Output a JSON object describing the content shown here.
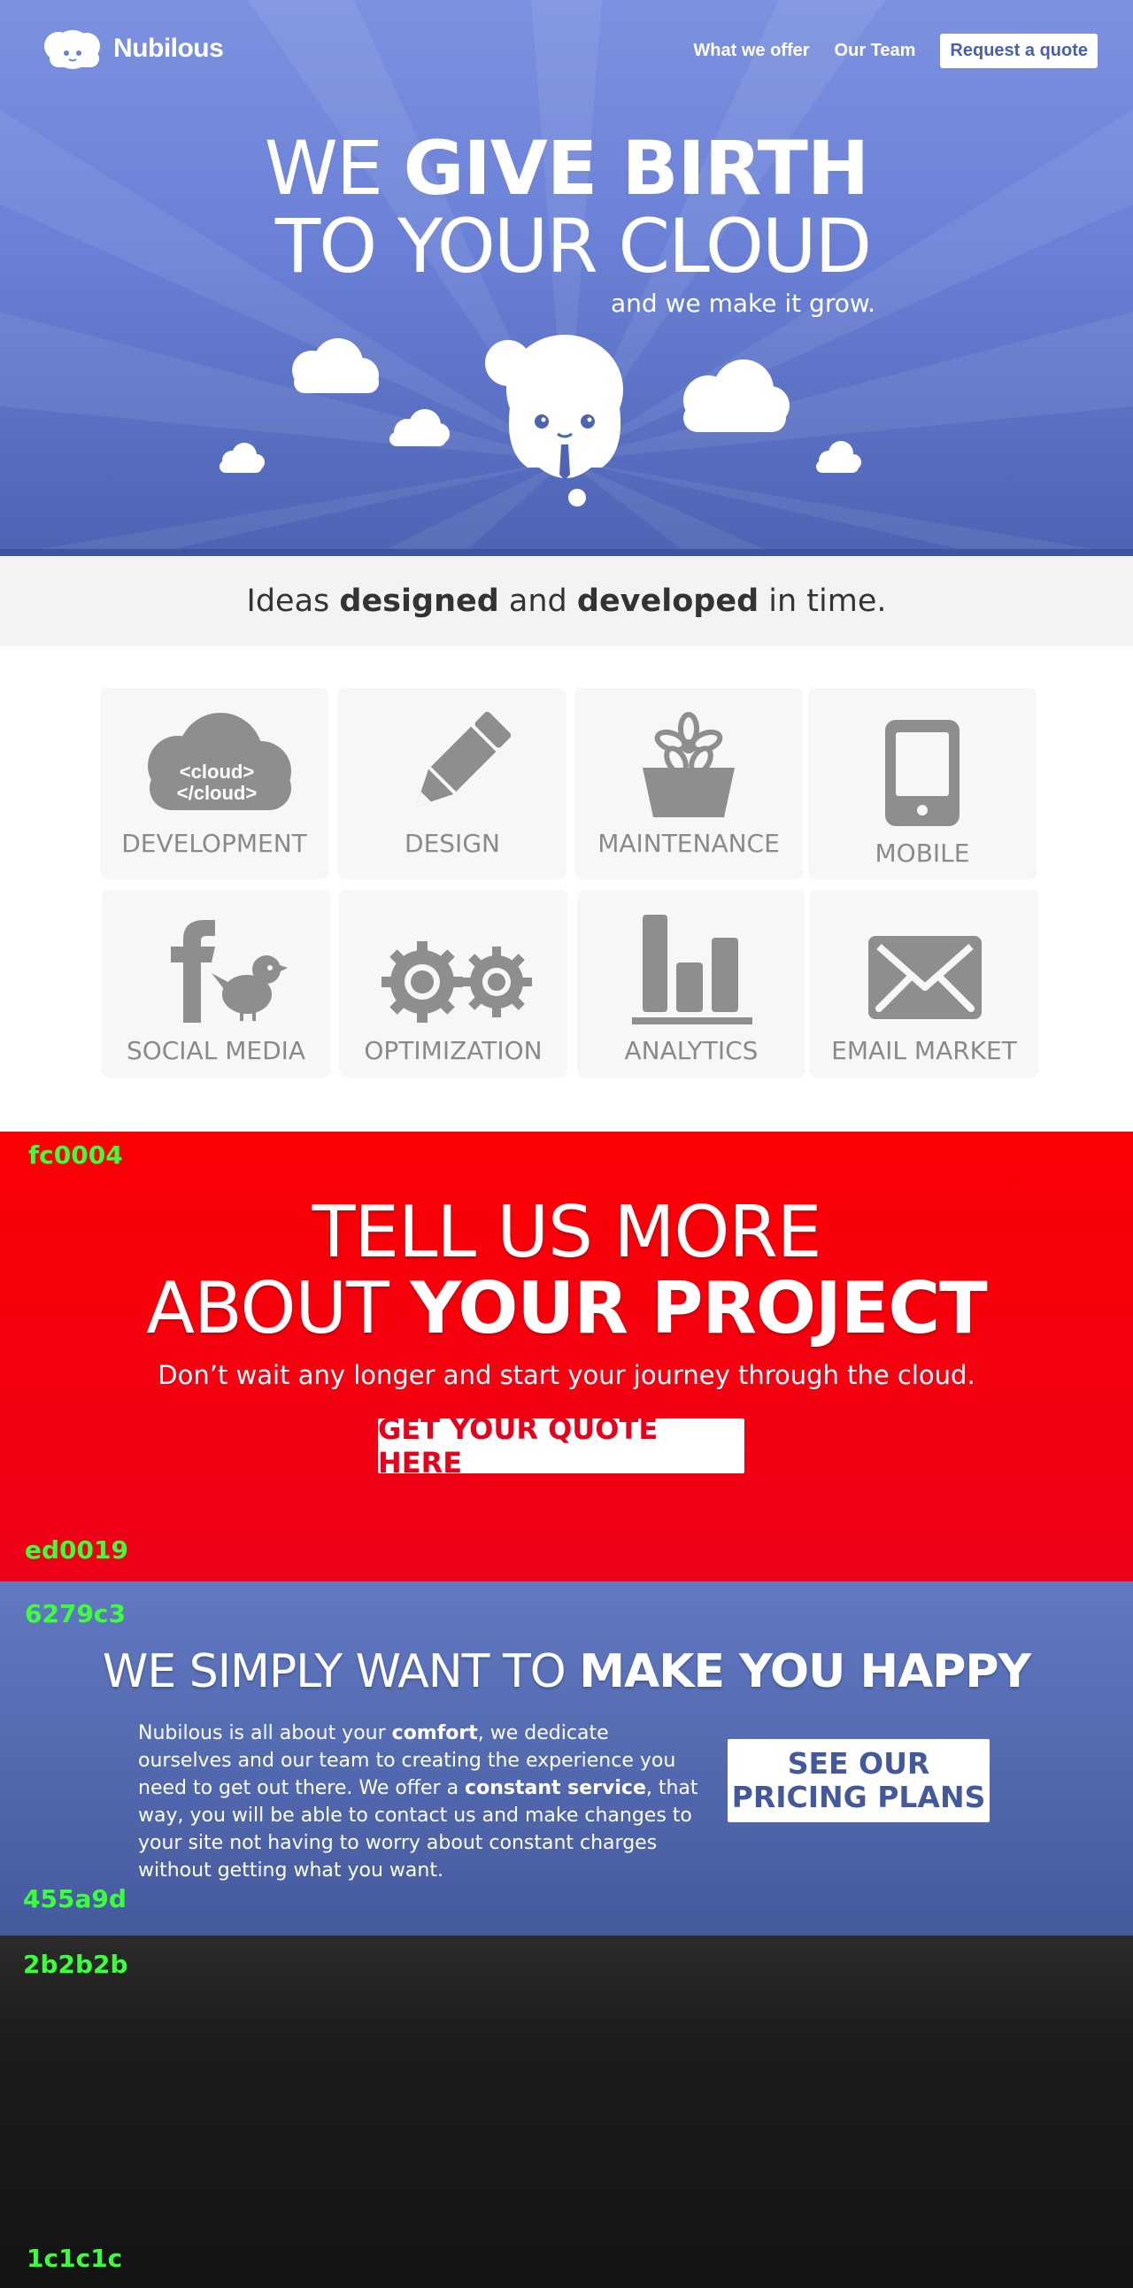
{
  "brand": {
    "name": "Nubilous"
  },
  "nav": {
    "items": [
      "What we offer",
      "Our Team"
    ],
    "quote_label": "Request a quote"
  },
  "hero": {
    "line1_light": "WE ",
    "line1_bold": "GIVE BIRTH",
    "line2": "TO YOUR CLOUD",
    "tagline": "and we make it grow."
  },
  "ideas": {
    "pre": "Ideas ",
    "bold1": "designed",
    "mid": " and ",
    "bold2": "developed",
    "post": " in time."
  },
  "services": {
    "items": [
      {
        "label": "DEVELOPMENT",
        "icon": "cloud-code-icon",
        "icon_text_1": "<cloud>",
        "icon_text_2": "</cloud>"
      },
      {
        "label": "DESIGN",
        "icon": "pencil-icon"
      },
      {
        "label": "MAINTENANCE",
        "icon": "flower-pot-icon"
      },
      {
        "label": "MOBILE",
        "icon": "phone-icon"
      },
      {
        "label": "SOCIAL MEDIA",
        "icon": "social-icon"
      },
      {
        "label": "OPTIMIZATION",
        "icon": "gears-icon"
      },
      {
        "label": "ANALYTICS",
        "icon": "bar-chart-icon"
      },
      {
        "label": "EMAIL MARKET",
        "icon": "envelope-icon"
      }
    ]
  },
  "cta": {
    "swatch_top": "fc0004",
    "swatch_bottom": "ed0019",
    "line1": "TELL US MORE",
    "line2_light": "ABOUT ",
    "line2_bold": "YOUR PROJECT",
    "subtitle": "Don’t wait any longer and start your journey through the cloud.",
    "button": "GET YOUR QUOTE HERE"
  },
  "happy": {
    "swatch_top": "6279c3",
    "swatch_bottom": "455a9d",
    "heading_light": "WE SIMPLY WANT TO ",
    "heading_bold": "MAKE YOU HAPPY",
    "p_1": "Nubilous is all about your ",
    "p_bold1": "comfort",
    "p_2": ", we dedicate ourselves and our team to creating the experience you need to get out there. We offer a ",
    "p_bold2": "constant service",
    "p_3": ", that way, you will be able to contact us and make changes to your site not having to worry about constant charges without getting what you want.",
    "button_line1": "SEE OUR",
    "button_line2": "PRICING PLANS"
  },
  "footer": {
    "swatch_top": "2b2b2b",
    "swatch_bottom": "1c1c1c"
  },
  "colors": {
    "hero_top": "#7d91e0",
    "hero_bottom": "#4d63b3",
    "cta_red": "#fc0004",
    "happy_blue": "#6279c3",
    "footer_dark": "#2b2b2b",
    "swatch_green": "#3cff3c"
  }
}
